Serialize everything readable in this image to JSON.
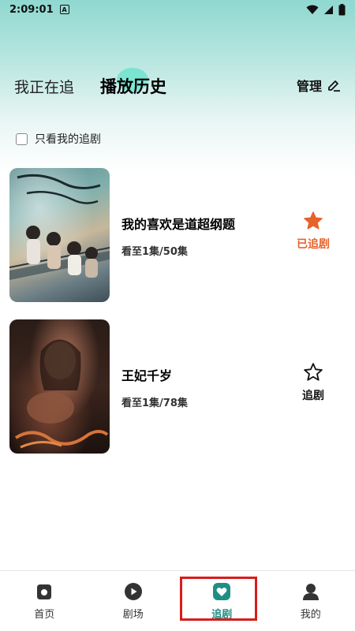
{
  "status_bar": {
    "time": "2:09:01",
    "notification_letter": "A"
  },
  "header": {
    "tab_following": "我正在追",
    "tab_history": "播放历史",
    "manage_label": "管理"
  },
  "filter": {
    "label": "只看我的追剧"
  },
  "dramas": [
    {
      "title": "我的喜欢是道超纲题",
      "progress": "看至1集/50集",
      "follow_label": "已追剧",
      "followed": true
    },
    {
      "title": "王妃千岁",
      "progress": "看至1集/78集",
      "follow_label": "追剧",
      "followed": false
    }
  ],
  "bottom_nav": [
    {
      "label": "首页",
      "icon": "home-icon"
    },
    {
      "label": "剧场",
      "icon": "play-icon"
    },
    {
      "label": "追剧",
      "icon": "heart-icon",
      "active": true
    },
    {
      "label": "我的",
      "icon": "profile-icon"
    }
  ],
  "colors": {
    "accent": "#1f8f86",
    "followed": "#e8632a",
    "highlight_box": "#d91c1c"
  }
}
